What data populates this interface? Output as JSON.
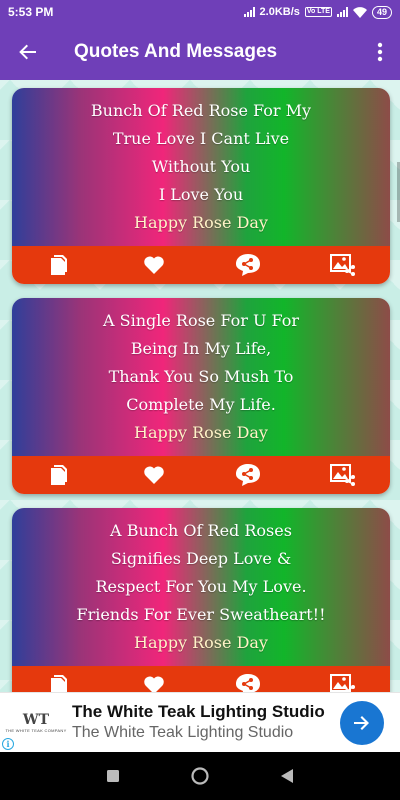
{
  "status_bar": {
    "time": "5:53 PM",
    "net_speed": "2.0KB/s",
    "volte": "Vo LTE",
    "battery": "49"
  },
  "app_bar": {
    "title": "Quotes And Messages",
    "back_icon": "arrow-back-icon",
    "menu_icon": "more-vert-icon"
  },
  "cards": [
    {
      "lines": [
        "Bunch Of Red Rose For My",
        "True Love I Cant Live",
        "Without You",
        "I Love You",
        "Happy Rose Day"
      ]
    },
    {
      "lines": [
        "A Single Rose For U For",
        "Being In My Life,",
        "Thank You So Mush To",
        "Complete My Life.",
        "Happy Rose Day"
      ]
    },
    {
      "lines": [
        "A Bunch Of Red Roses",
        "Signifies Deep Love &",
        "Respect For You My Love.",
        "Friends For Ever Sweatheart!!",
        "Happy Rose Day"
      ]
    }
  ],
  "card_actions": [
    "copy-icon",
    "heart-icon",
    "share-icon",
    "image-share-icon"
  ],
  "ad": {
    "logo_mono": "WT",
    "logo_sub": "THE WHITE TEAK COMPANY",
    "title": "The White Teak Lighting Studio",
    "subtitle": "The White Teak Lighting Studio",
    "info": "i"
  },
  "colors": {
    "app_bar": "#6f3fb8",
    "card_action_bar": "#e5390d",
    "ad_cta": "#1976d2"
  }
}
